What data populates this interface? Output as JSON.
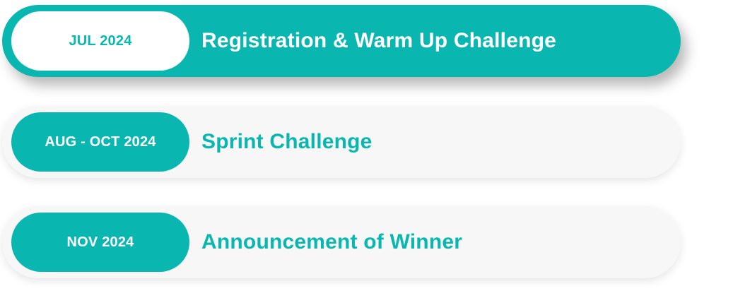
{
  "colors": {
    "accent": "#0ab7b0",
    "inactive_background": "#f7f7f7",
    "white": "#ffffff"
  },
  "timeline": {
    "items": [
      {
        "date": "JUL 2024",
        "title": "Registration & Warm Up Challenge",
        "state": "active"
      },
      {
        "date": "AUG - OCT 2024",
        "title": "Sprint Challenge",
        "state": "inactive"
      },
      {
        "date": "NOV 2024",
        "title": "Announcement of Winner",
        "state": "inactive"
      }
    ]
  }
}
